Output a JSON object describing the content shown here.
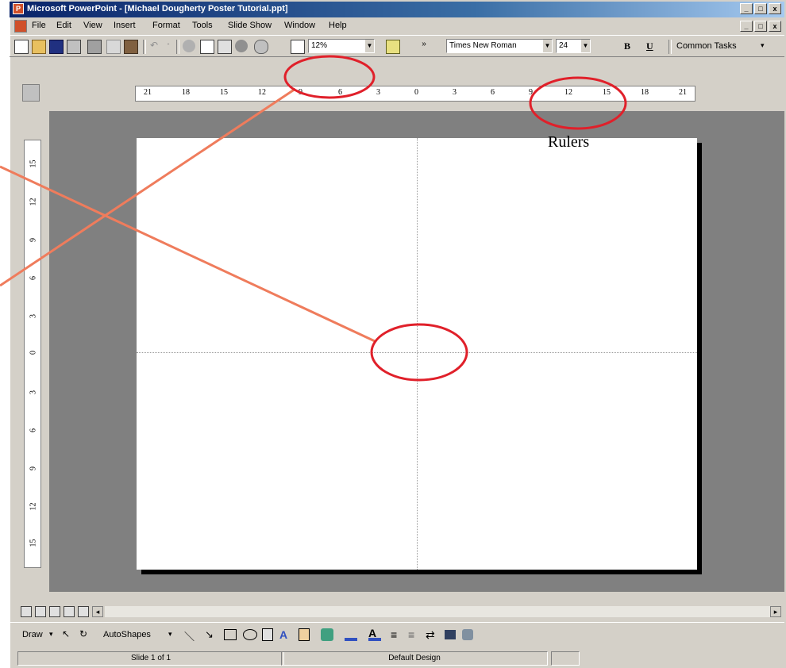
{
  "window": {
    "title": "Microsoft PowerPoint - [Michael Dougherty Poster Tutorial.ppt]",
    "app_icon": "powerpoint-icon",
    "caption_buttons": [
      "_",
      "□",
      "x"
    ]
  },
  "menubar": {
    "items": [
      "File",
      "Edit",
      "View",
      "Insert",
      "Format",
      "Tools",
      "Slide Show",
      "Window",
      "Help"
    ]
  },
  "toolbar": {
    "zoom_value": "12%",
    "font_name": "Times New Roman",
    "font_size": "24",
    "bold_label": "B",
    "underline_label": "U",
    "common_tasks_label": "Common Tasks"
  },
  "rulers": {
    "horizontal_ticks": [
      "21",
      "18",
      "15",
      "12",
      "9",
      "6",
      "3",
      "0",
      "3",
      "6",
      "9",
      "12",
      "15",
      "18",
      "21"
    ],
    "vertical_ticks": [
      "15",
      "12",
      "9",
      "6",
      "3",
      "0",
      "3",
      "6",
      "9",
      "12",
      "15"
    ]
  },
  "annotation": {
    "label": "Rulers",
    "color": "#e0202a",
    "line_color": "#ef7c5c"
  },
  "drawing_toolbar": {
    "draw_label": "Draw",
    "autoshapes_label": "AutoShapes"
  },
  "statusbar": {
    "slide_label": "Slide 1 of 1",
    "design_label": "Default Design"
  }
}
